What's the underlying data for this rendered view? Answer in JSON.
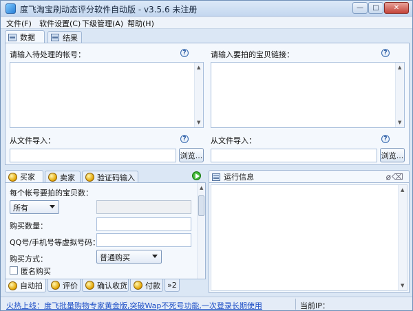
{
  "window": {
    "title": "度飞淘宝刷动态评分软件自动版 - v3.5.6 未注册",
    "controls": {
      "minimize": "—",
      "maximize": "□",
      "close": "✕"
    }
  },
  "menu": [
    "文件(F)",
    "软件设置(C)",
    "下级管理(A)",
    "帮助(H)"
  ],
  "top_tabs": {
    "tab1": "数据",
    "tab2": "结果"
  },
  "data_panel": {
    "accounts_label": "请输入待处理的帐号：",
    "links_label": "请输入要拍的宝贝链接：",
    "import_label_left": "从文件导入：",
    "import_label_right": "从文件导入：",
    "browse_left": "浏览...",
    "browse_right": "浏览...",
    "help_glyph": "?"
  },
  "lower_tabs": {
    "buyer": "买家",
    "seller": "卖家",
    "captcha": "验证码输入"
  },
  "buyer_panel": {
    "items_per_account_label": "每个帐号要拍的宝贝数：",
    "items_select": "所有",
    "quantity_label": "购买数量：",
    "virtual_label": "QQ号/手机号等虚拟号码：",
    "method_label": "购买方式：",
    "method_select": "普通购买",
    "anonymous_label": "匿名购买"
  },
  "bottom_tabs": {
    "auto": "自动拍",
    "review": "评价",
    "confirm": "确认收货",
    "pay": "付款",
    "more": "»2"
  },
  "log_panel": {
    "title": "运行信息"
  },
  "status": {
    "link": "火热上线：度飞批量购物专家黄金版,突破Wap不死号功能,一次登录长期使用",
    "ip_label": "当前IP："
  },
  "colors": {
    "accent": "#3b6cb0",
    "link": "#1e4fc6",
    "close": "#c4443a",
    "play": "#1f9a18"
  }
}
